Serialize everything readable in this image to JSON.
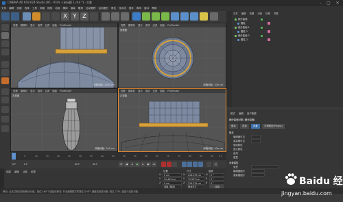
{
  "window": {
    "title": "CINEMA 4D R19.024 Studio (RC - R19) - [未标题 1.c4d *] - 主要",
    "min": "–",
    "max": "▢",
    "close": "✕"
  },
  "menu": [
    "文件",
    "编辑",
    "创建",
    "选择",
    "工具",
    "网格",
    "捕捉",
    "动画",
    "模拟",
    "渲染",
    "雕刻",
    "运动跟踪",
    "运动图形",
    "角色",
    "流水线",
    "插件",
    "脚本",
    "窗口",
    "帮助"
  ],
  "toolbar": {
    "x": "X",
    "y": "Y",
    "z": "Z"
  },
  "viewports": {
    "perspective": {
      "menu": [
        "查看",
        "摄像机",
        "显示",
        "选项",
        "过滤",
        "面板",
        "ProRender"
      ],
      "name": "透视视图",
      "grid": "网格间距: 1000 cm"
    },
    "top": {
      "menu": [
        "查看",
        "摄像机",
        "显示",
        "选项",
        "过滤",
        "面板",
        "ProRender"
      ],
      "name": "顶视图",
      "grid": "网格间距: 100 cm"
    },
    "right": {
      "menu": [
        "查看",
        "摄像机",
        "显示",
        "选项",
        "过滤",
        "面板",
        "ProRender"
      ],
      "name": "右视图",
      "grid": "网格间距: 100 cm"
    },
    "front": {
      "menu": [
        "查看",
        "摄像机",
        "显示",
        "选项",
        "过滤",
        "面板",
        "ProRender"
      ],
      "name": "正视图",
      "grid": "网格间距: 100 cm"
    }
  },
  "object_manager": {
    "menu": [
      "文件",
      "编辑",
      "查看",
      "对象",
      "标签",
      "书签"
    ],
    "rows": [
      "细分曲面",
      "圆柱",
      "细分曲面.1",
      "圆柱.1",
      "细分曲面.2",
      "圆柱.2"
    ]
  },
  "attribute_manager": {
    "menu": [
      "模式",
      "编辑",
      "用户数据"
    ],
    "title": "细分曲面对象 [细分曲面]",
    "tabs": [
      "基本",
      "坐标",
      "对象",
      "平滑着色(Phong)"
    ],
    "section_basic": "基本",
    "rows": [
      "编辑器可见",
      "渲染器可见",
      "使用颜色",
      "显示颜色",
      "启用",
      "透显"
    ],
    "section_obj": "对象属性",
    "obj_rows": [
      "类型",
      "编辑器细分",
      "渲染器细分"
    ]
  },
  "timeline": {
    "ticks": [
      "0",
      "5",
      "10",
      "15",
      "20",
      "25",
      "30",
      "35",
      "40",
      "45",
      "50",
      "55",
      "60",
      "65",
      "70",
      "75",
      "80",
      "85",
      "90"
    ],
    "end": "0 F"
  },
  "playbar": {
    "start": "0 F",
    "current": "0 F",
    "end_a": "90 F",
    "end_b": "90 F"
  },
  "material": {
    "menu": [
      "创建",
      "编辑",
      "功能",
      "纹理"
    ]
  },
  "coords": {
    "headers": [
      "位置",
      "尺寸",
      "旋转"
    ],
    "x": [
      "X",
      "0 cm",
      "X",
      "216.279 cm",
      "H",
      "0 °"
    ],
    "y": [
      "Y",
      "11.443 cm",
      "Y",
      "71.207 cm",
      "P",
      "0 °"
    ],
    "z": [
      "Z",
      "0 cm",
      "Z",
      "216.279 cm",
      "B",
      "0 °"
    ],
    "mode": "对象 (相对)",
    "size_mode": "绝对尺寸",
    "apply": "应用"
  },
  "status": "移动: 点击并拖动鼠标移动元素。按住 SHIFT 键量化移动; 节点编辑模式时按住 SHIFT 键增加选择对象; 按住 CTRL 键减少选择对象。",
  "watermark": {
    "brand": "Baidu 经验",
    "url": "jingyan.baidu.com"
  }
}
